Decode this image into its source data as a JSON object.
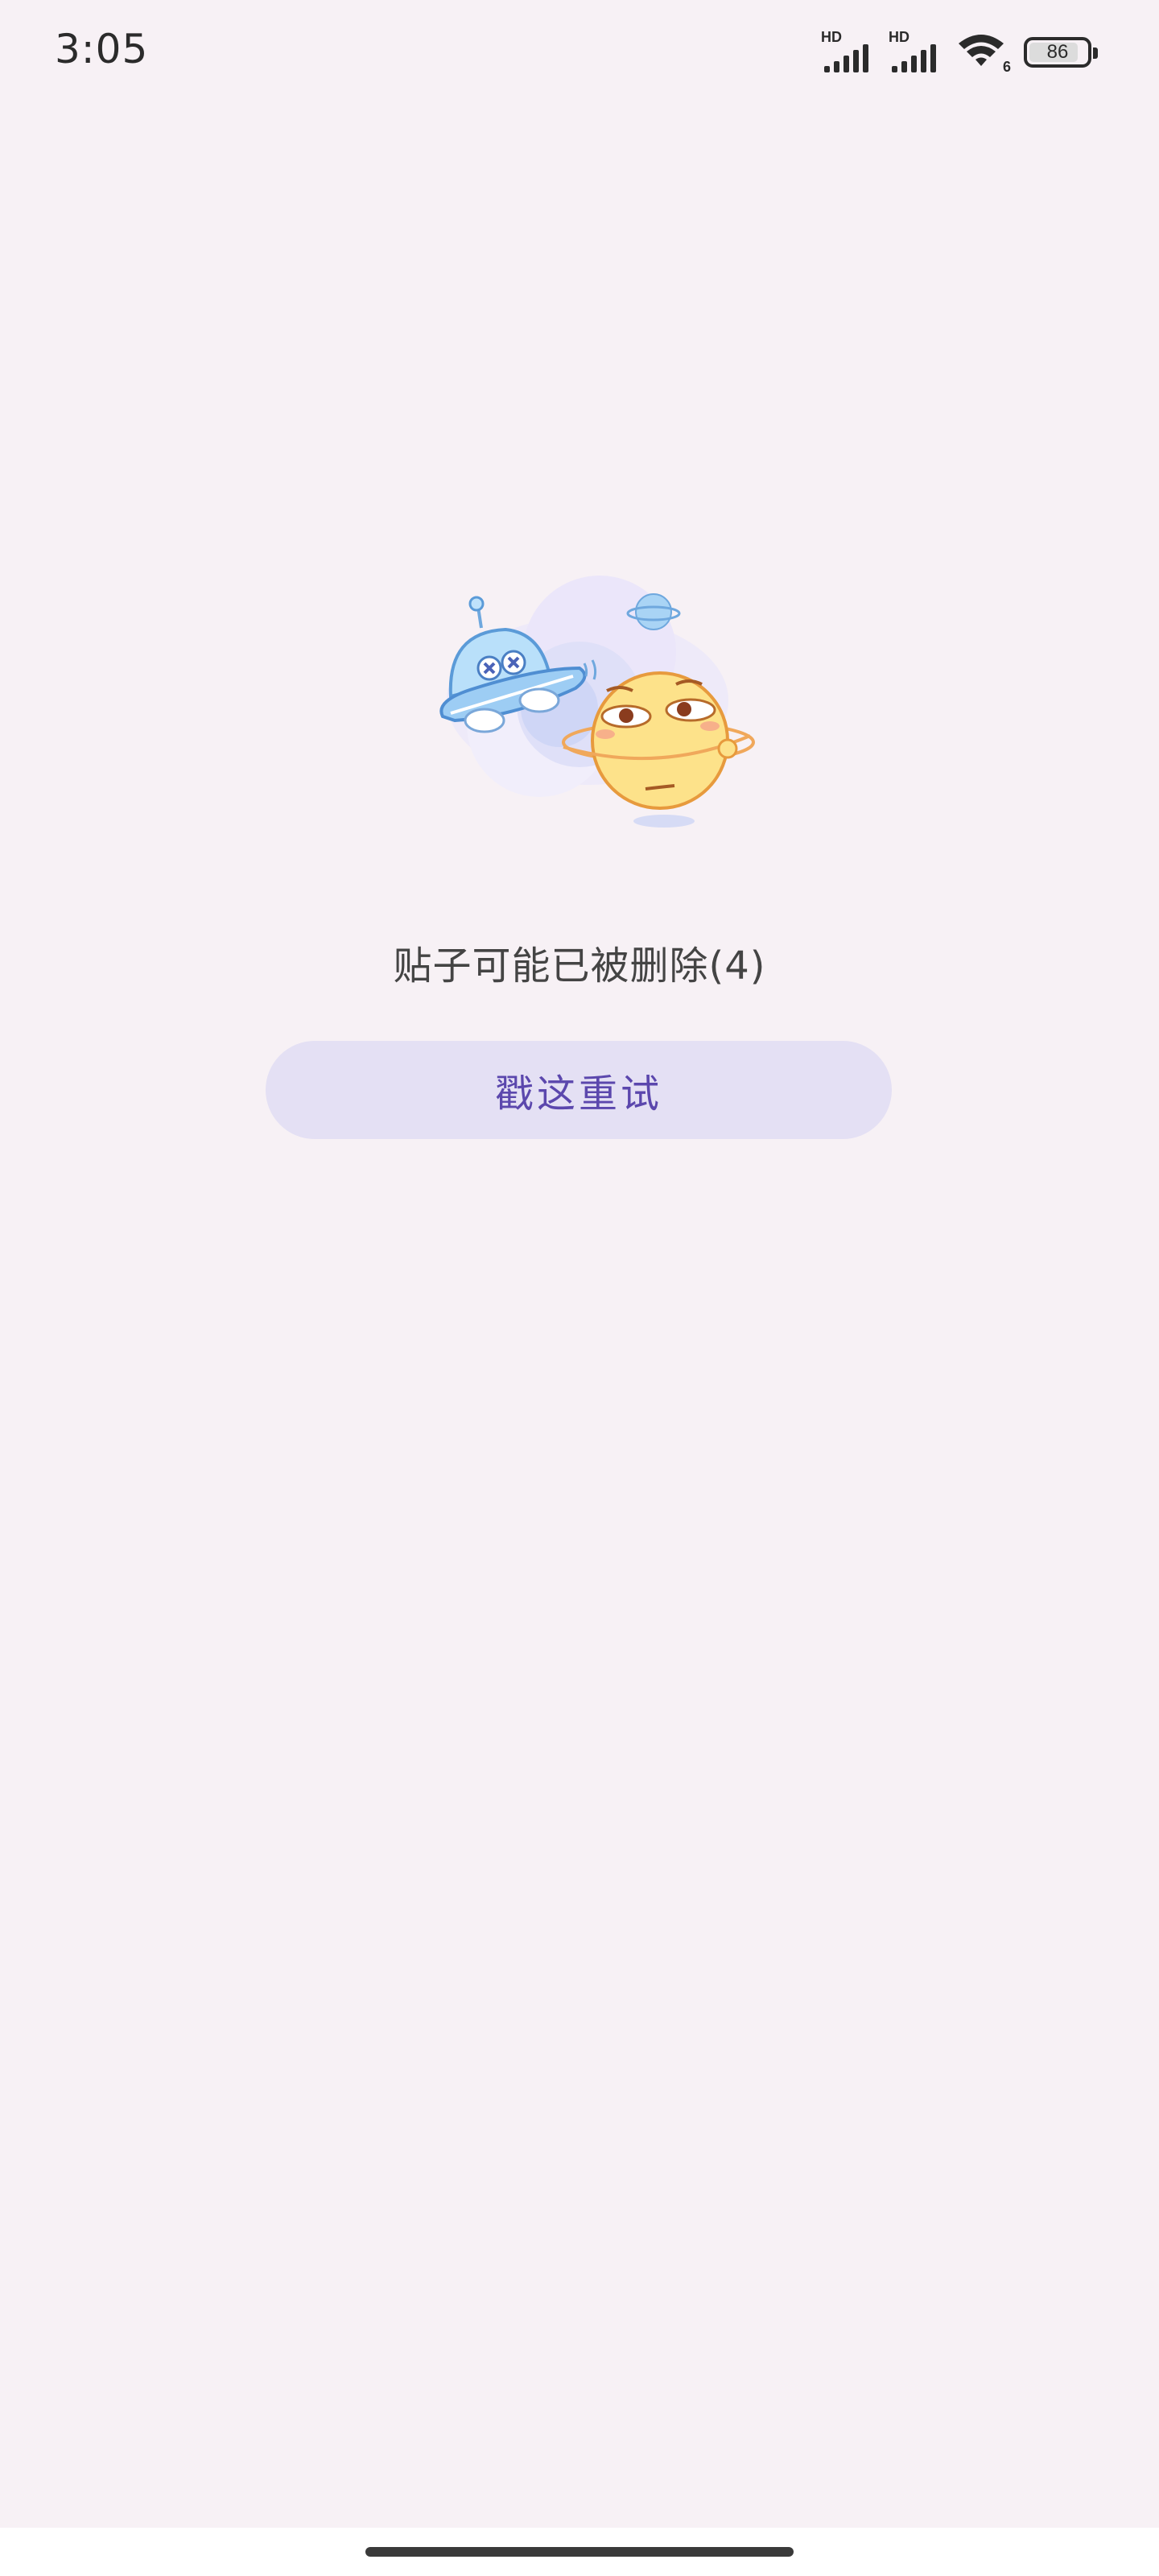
{
  "status_bar": {
    "time": "3:05",
    "signal_1_label": "HD",
    "signal_2_label": "HD",
    "wifi_badge": "6",
    "battery_level": "86",
    "battery_percent": 86
  },
  "illustration": {
    "icon": "ufo-and-planet-illustration"
  },
  "main": {
    "message": "贴子可能已被删除(4)",
    "retry_label": "戳这重试"
  },
  "colors": {
    "background": "#f7f1f5",
    "button_bg": "#e4e0f4",
    "button_text": "#5b47ad",
    "message_text": "#444444"
  }
}
